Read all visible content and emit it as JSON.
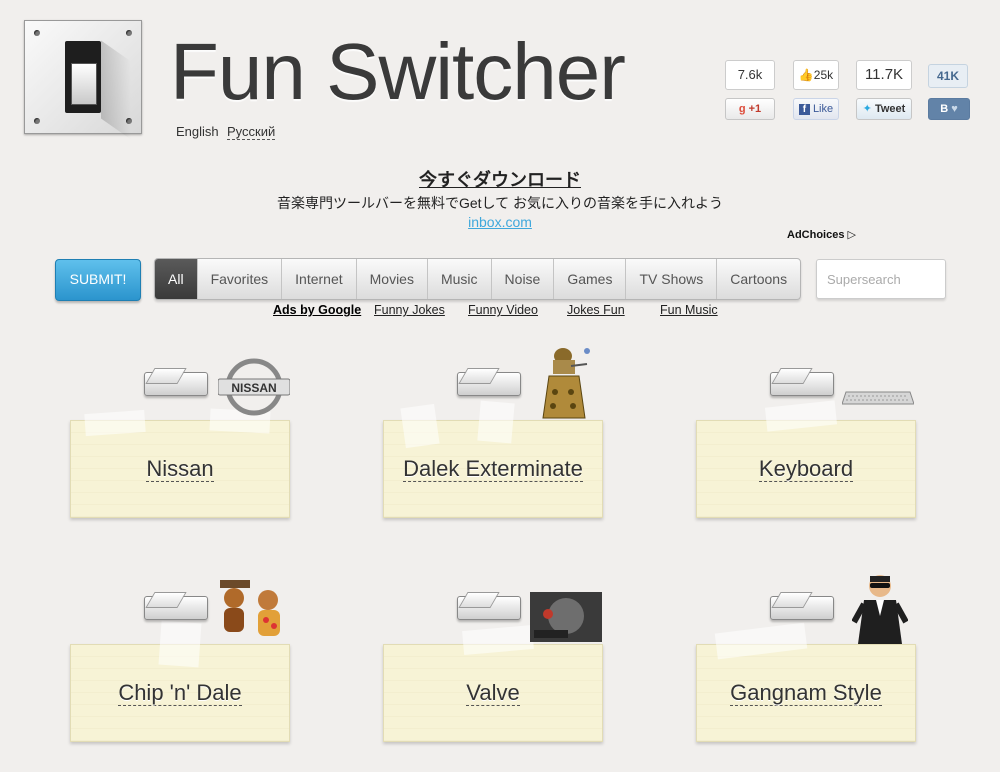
{
  "header": {
    "title": "Fun Switcher",
    "languages": [
      "English",
      "Русский"
    ]
  },
  "social": {
    "gplus": {
      "count": "7.6k",
      "label": "+1"
    },
    "facebook": {
      "count": "25k",
      "label": "Like"
    },
    "twitter": {
      "count": "11.7K",
      "label": "Tweet"
    },
    "vk": {
      "count": "41K",
      "label": "B"
    }
  },
  "ad": {
    "title": "今すぐダウンロード",
    "text": "音楽専門ツールバーを無料でGetして お気に入りの音楽を手に入れよう",
    "link": "inbox.com",
    "adchoices": "AdChoices ▷"
  },
  "nav": {
    "submit": "SUBMIT!",
    "tabs": [
      "All",
      "Favorites",
      "Internet",
      "Movies",
      "Music",
      "Noise",
      "Games",
      "TV Shows",
      "Cartoons"
    ],
    "active_tab": "All",
    "search_placeholder": "Supersearch"
  },
  "ads_bar": [
    "Ads by Google",
    "Funny Jokes",
    "Funny Video",
    "Jokes Fun",
    "Fun Music"
  ],
  "cards": [
    {
      "label": "Nissan",
      "icon": "nissan-logo"
    },
    {
      "label": "Dalek Exterminate",
      "icon": "dalek-figure"
    },
    {
      "label": "Keyboard",
      "icon": "keyboard"
    },
    {
      "label": "Chip 'n' Dale",
      "icon": "chipmunks"
    },
    {
      "label": "Valve",
      "icon": "valve-logo"
    },
    {
      "label": "Gangnam Style",
      "icon": "psy-figure"
    }
  ],
  "colors": {
    "accent": "#2b94cd",
    "background": "#f1efed",
    "note": "#f7f3d6"
  }
}
